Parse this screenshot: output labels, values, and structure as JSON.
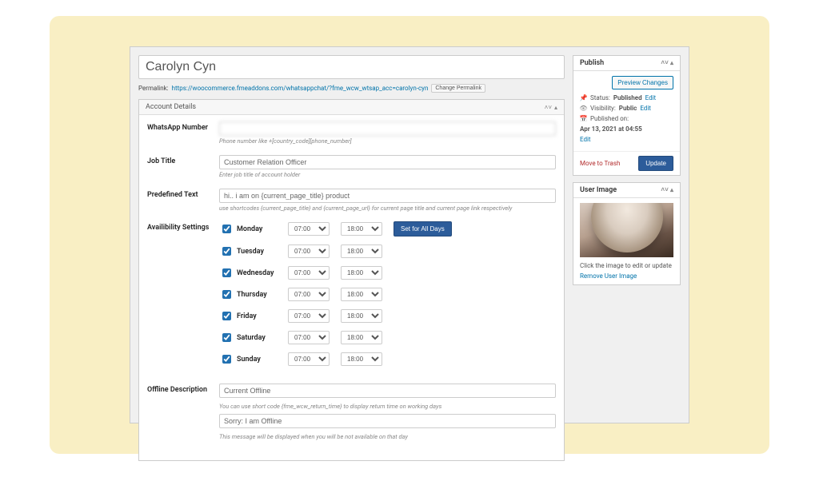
{
  "title": "Carolyn Cyn",
  "permalink": {
    "label": "Permalink:",
    "url": "https://woocommerce.fmeaddons.com/whatsappchat/?fme_wcw_wtsap_acc=carolyn-cyn",
    "changeBtn": "Change Permalink"
  },
  "accountDetails": {
    "panelTitle": "Account Details",
    "fields": {
      "whatsapp": {
        "label": "WhatsApp Number",
        "value": "",
        "hint": "Phone number like +[country_code][phone_number]"
      },
      "jobTitle": {
        "label": "Job Title",
        "value": "Customer Relation Officer",
        "hint": "Enter job title of account holder"
      },
      "predefined": {
        "label": "Predefined Text",
        "value": "hi.. i am on {current_page_title} product",
        "hint": "use shortcodes {current_page_title} and {current_page_url} for current page title and current page link respectively"
      },
      "offline1": {
        "label": "Offline Description",
        "value": "Current Offline",
        "hint": "You can use short code {fme_wcw_return_time} to display return time on working days"
      },
      "offline2": {
        "value": "Sorry: I am Offline",
        "hint": "This message will be displayed when you will be not available on that day"
      }
    },
    "availability": {
      "label": "Availibility Settings",
      "setAllBtn": "Set for All Days",
      "days": [
        {
          "name": "Monday",
          "checked": true,
          "from": "07:00",
          "to": "18:00"
        },
        {
          "name": "Tuesday",
          "checked": true,
          "from": "07:00",
          "to": "18:00"
        },
        {
          "name": "Wednesday",
          "checked": true,
          "from": "07:00",
          "to": "18:00"
        },
        {
          "name": "Thursday",
          "checked": true,
          "from": "07:00",
          "to": "18:00"
        },
        {
          "name": "Friday",
          "checked": true,
          "from": "07:00",
          "to": "18:00"
        },
        {
          "name": "Saturday",
          "checked": true,
          "from": "07:00",
          "to": "18:00"
        },
        {
          "name": "Sunday",
          "checked": true,
          "from": "07:00",
          "to": "18:00"
        }
      ]
    }
  },
  "publish": {
    "title": "Publish",
    "previewBtn": "Preview Changes",
    "status": {
      "label": "Status:",
      "value": "Published",
      "editLink": "Edit"
    },
    "visibility": {
      "label": "Visibility:",
      "value": "Public",
      "editLink": "Edit"
    },
    "published": {
      "label": "Published on:",
      "value": "Apr 13, 2021 at 04:55",
      "editLink": "Edit"
    },
    "trashLink": "Move to Trash",
    "updateBtn": "Update"
  },
  "userImage": {
    "title": "User Image",
    "hint": "Click the image to edit or update",
    "removeLink": "Remove User Image"
  }
}
